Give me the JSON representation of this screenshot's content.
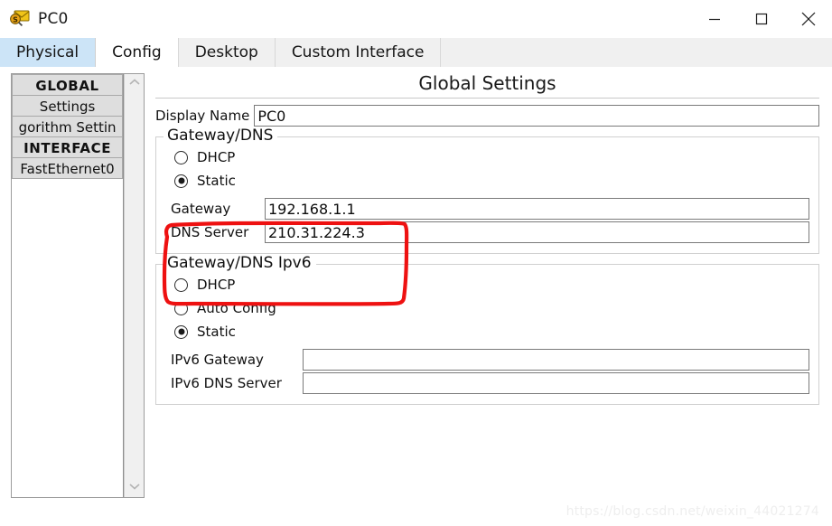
{
  "window": {
    "title": "PC0",
    "icon": "packet-tracer-icon",
    "controls": {
      "minimize": "minimize-icon",
      "maximize": "maximize-icon",
      "close": "close-icon"
    }
  },
  "tabs": [
    {
      "label": "Physical",
      "state": "hover"
    },
    {
      "label": "Config",
      "state": "active"
    },
    {
      "label": "Desktop",
      "state": "normal"
    },
    {
      "label": "Custom Interface",
      "state": "normal"
    }
  ],
  "sidebar": {
    "items": [
      {
        "label": "GLOBAL",
        "kind": "header"
      },
      {
        "label": "Settings",
        "kind": "item"
      },
      {
        "label": "gorithm Settin",
        "kind": "item"
      },
      {
        "label": "INTERFACE",
        "kind": "header"
      },
      {
        "label": "FastEthernet0",
        "kind": "item"
      }
    ],
    "scroll_up": "▲",
    "scroll_down": "▼"
  },
  "panel": {
    "title": "Global Settings",
    "display_name": {
      "label": "Display Name",
      "value": "PC0",
      "placeholder": ""
    },
    "gateway_dns": {
      "legend": "Gateway/DNS",
      "options": [
        {
          "label": "DHCP",
          "selected": false
        },
        {
          "label": "Static",
          "selected": true
        }
      ],
      "fields": [
        {
          "label": "Gateway",
          "value": "192.168.1.1",
          "placeholder": ""
        },
        {
          "label": "DNS Server",
          "value": "210.31.224.3",
          "placeholder": ""
        }
      ]
    },
    "gateway_dns_ipv6": {
      "legend": "Gateway/DNS Ipv6",
      "options": [
        {
          "label": "DHCP",
          "selected": false
        },
        {
          "label": "Auto Config",
          "selected": false
        },
        {
          "label": "Static",
          "selected": true
        }
      ],
      "fields": [
        {
          "label": "IPv6 Gateway",
          "value": "",
          "placeholder": ""
        },
        {
          "label": "IPv6 DNS Server",
          "value": "",
          "placeholder": ""
        }
      ]
    }
  },
  "annotation": {
    "color": "#ee1111",
    "shape": "hand-drawn-rectangle"
  },
  "watermark": {
    "text": "https://blog.csdn.net/weixin_44021274"
  }
}
